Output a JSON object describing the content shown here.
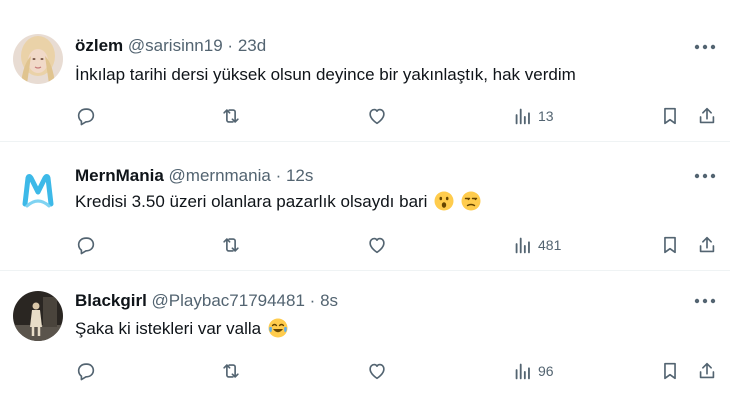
{
  "tweets": [
    {
      "name": "özlem",
      "handle": "@sarisinn19",
      "separator": "·",
      "time": "23d",
      "text": "İnkılap tarihi dersi yüksek olsun deyince bir yakınlaştık, hak verdim",
      "emojis": [],
      "views": "13",
      "avatar_icon": "woman-photo-avatar"
    },
    {
      "name": "MernMania",
      "handle": "@mernmania",
      "separator": "·",
      "time": "12s",
      "text": "Kredisi 3.50 üzeri olanlara pazarlık olsaydı bari",
      "emojis": [
        "astonished-face-emoji",
        "unamused-face-emoji"
      ],
      "views": "481",
      "avatar_icon": "mernmania-logo-avatar"
    },
    {
      "name": "Blackgirl",
      "handle": "@Playbac71794481",
      "separator": "·",
      "time": "8s",
      "text": "Şaka ki istekleri var valla",
      "emojis": [
        "crying-laughing-emoji"
      ],
      "views": "96",
      "avatar_icon": "person-photo-avatar"
    }
  ],
  "colors": {
    "text_primary": "#0f1419",
    "text_secondary": "#536471",
    "divider": "#eff3f4",
    "logo_blue": "#3db9e8"
  }
}
